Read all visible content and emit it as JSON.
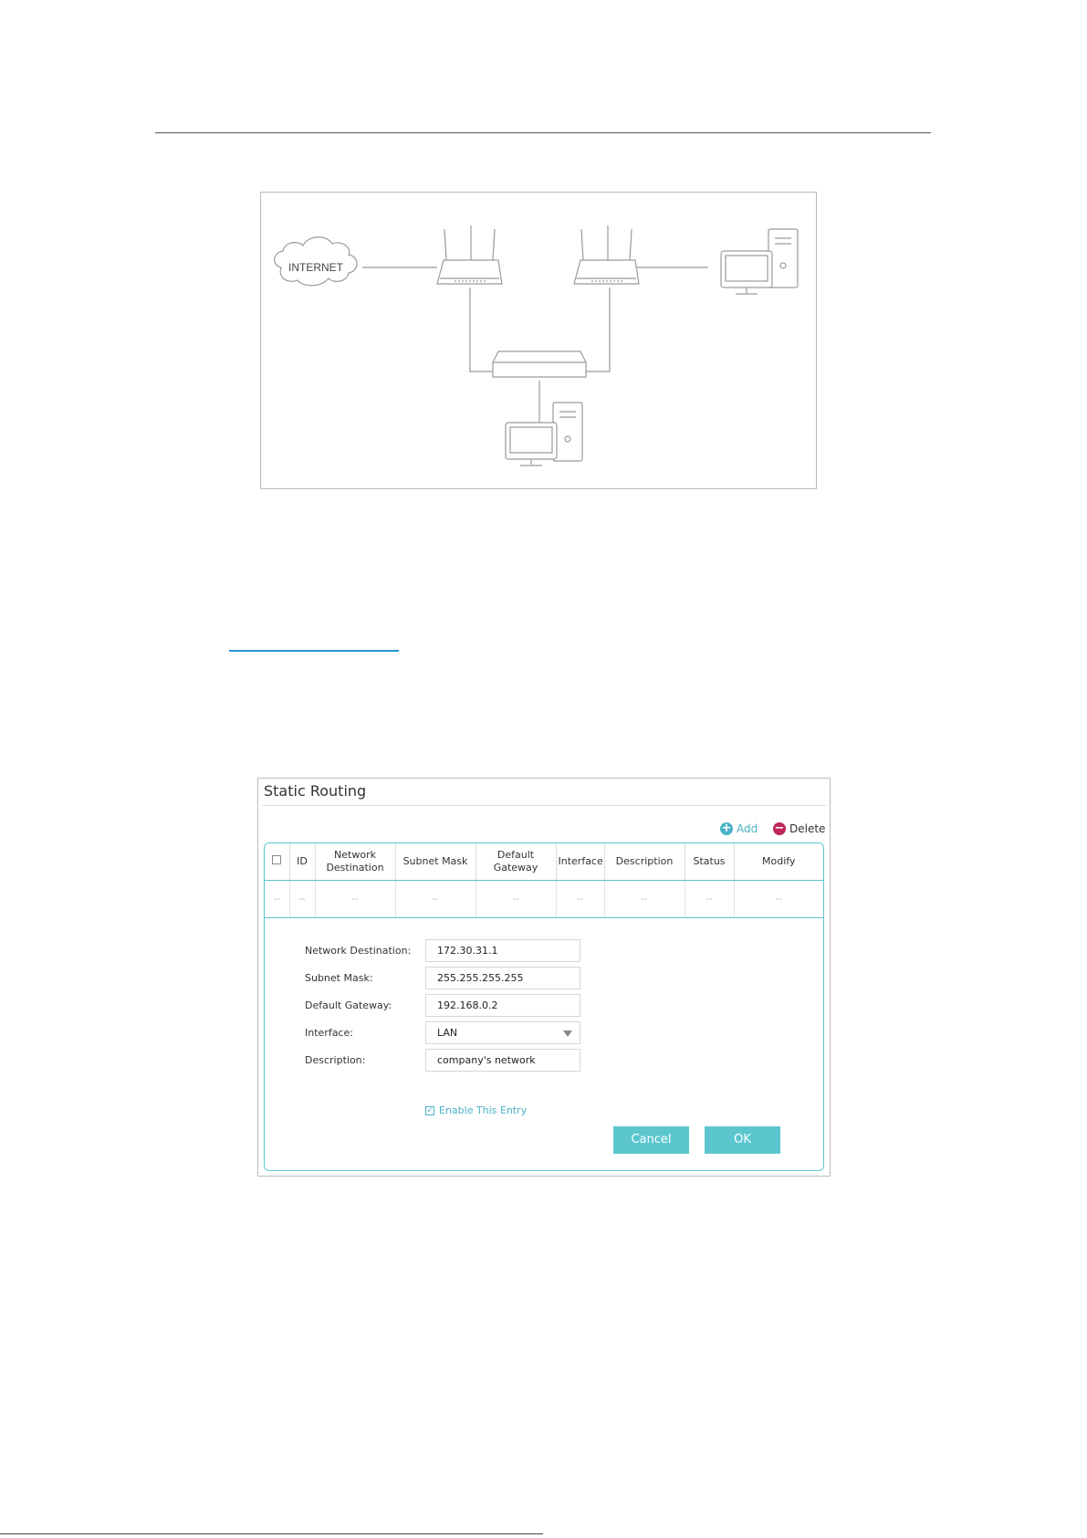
{
  "diagram": {
    "internet_label": "INTERNET"
  },
  "panel": {
    "title": "Static Routing",
    "add_label": "Add",
    "delete_label": "Delete",
    "columns": [
      "ID",
      "Network Destination",
      "Subnet Mask",
      "Default Gateway",
      "Interface",
      "Description",
      "Status",
      "Modify"
    ],
    "empty_row": [
      "--",
      "--",
      "--",
      "--",
      "--",
      "--",
      "--",
      "--",
      "--"
    ],
    "form": {
      "network_destination_label": "Network Destination:",
      "network_destination_value": "172.30.31.1",
      "subnet_mask_label": "Subnet Mask:",
      "subnet_mask_value": "255.255.255.255",
      "default_gateway_label": "Default Gateway:",
      "default_gateway_value": "192.168.0.2",
      "interface_label": "Interface:",
      "interface_value": "LAN",
      "description_label": "Description:",
      "description_value": "company's network",
      "enable_label": "Enable This Entry",
      "enable_checked": true
    },
    "cancel_label": "Cancel",
    "ok_label": "OK"
  },
  "colors": {
    "accent": "#5cc6cf",
    "link": "#1e9ad6",
    "delete": "#c0265a"
  }
}
